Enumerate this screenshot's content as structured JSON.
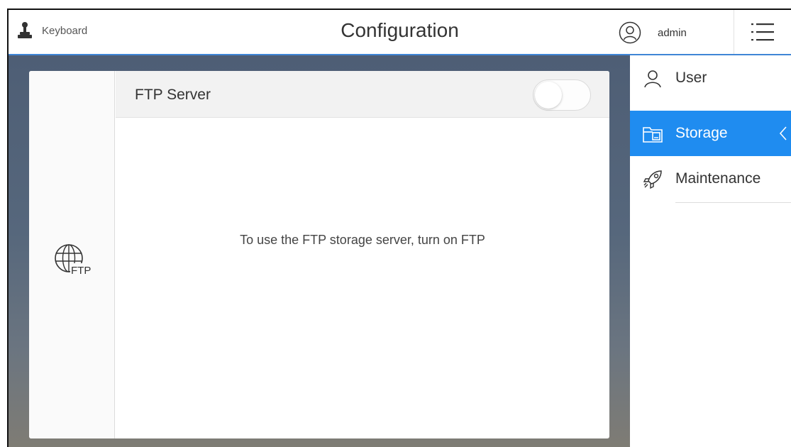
{
  "header": {
    "keyboard_label": "Keyboard",
    "title": "Configuration",
    "username": "admin",
    "icons": {
      "keyboard": "joystick-icon",
      "user": "user-circle-icon",
      "menu": "hamburger-menu-icon"
    }
  },
  "card": {
    "title": "FTP Server",
    "message": "To use the FTP storage server, turn on FTP",
    "toggle_on": false,
    "icon": "ftp-globe-icon",
    "icon_text": "FTP"
  },
  "sidebar": {
    "items": [
      {
        "label": "User",
        "icon": "user-icon",
        "active": false
      },
      {
        "label": "Storage",
        "icon": "storage-icon",
        "active": true
      },
      {
        "label": "Maintenance",
        "icon": "rocket-icon",
        "active": false
      }
    ]
  },
  "colors": {
    "accent": "#1f8cf0",
    "header_underline": "#3f86d6"
  }
}
